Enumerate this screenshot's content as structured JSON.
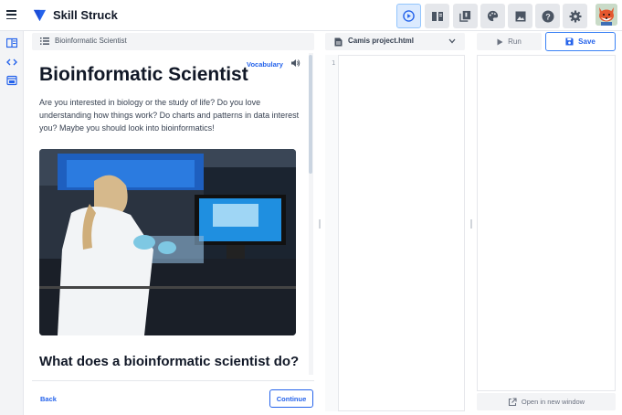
{
  "app": {
    "brand": "Skill Struck",
    "accent": "#2563eb"
  },
  "toolbar": {
    "buttons": [
      {
        "name": "play-icon",
        "active": true
      },
      {
        "name": "book-icon"
      },
      {
        "name": "library-icon"
      },
      {
        "name": "palette-icon"
      },
      {
        "name": "image-icon"
      },
      {
        "name": "help-icon"
      },
      {
        "name": "gear-icon"
      }
    ],
    "avatar": "fox-avatar"
  },
  "lesson": {
    "breadcrumb": "Bioinformatic Scientist",
    "vocabulary_label": "Vocabulary",
    "title": "Bioinformatic Scientist",
    "intro": "Are you interested in biology or the study of life? Do you love understanding how things work? Do charts and patterns in data interest you? Maybe you should look into bioinformatics!",
    "section_title": "What does a bioinformatic scientist do?",
    "back_label": "Back",
    "continue_label": "Continue"
  },
  "editor": {
    "file_name": "Camis project.html",
    "line_numbers": [
      "1"
    ]
  },
  "preview": {
    "run_label": "Run",
    "save_label": "Save",
    "open_new_label": "Open in new window"
  }
}
